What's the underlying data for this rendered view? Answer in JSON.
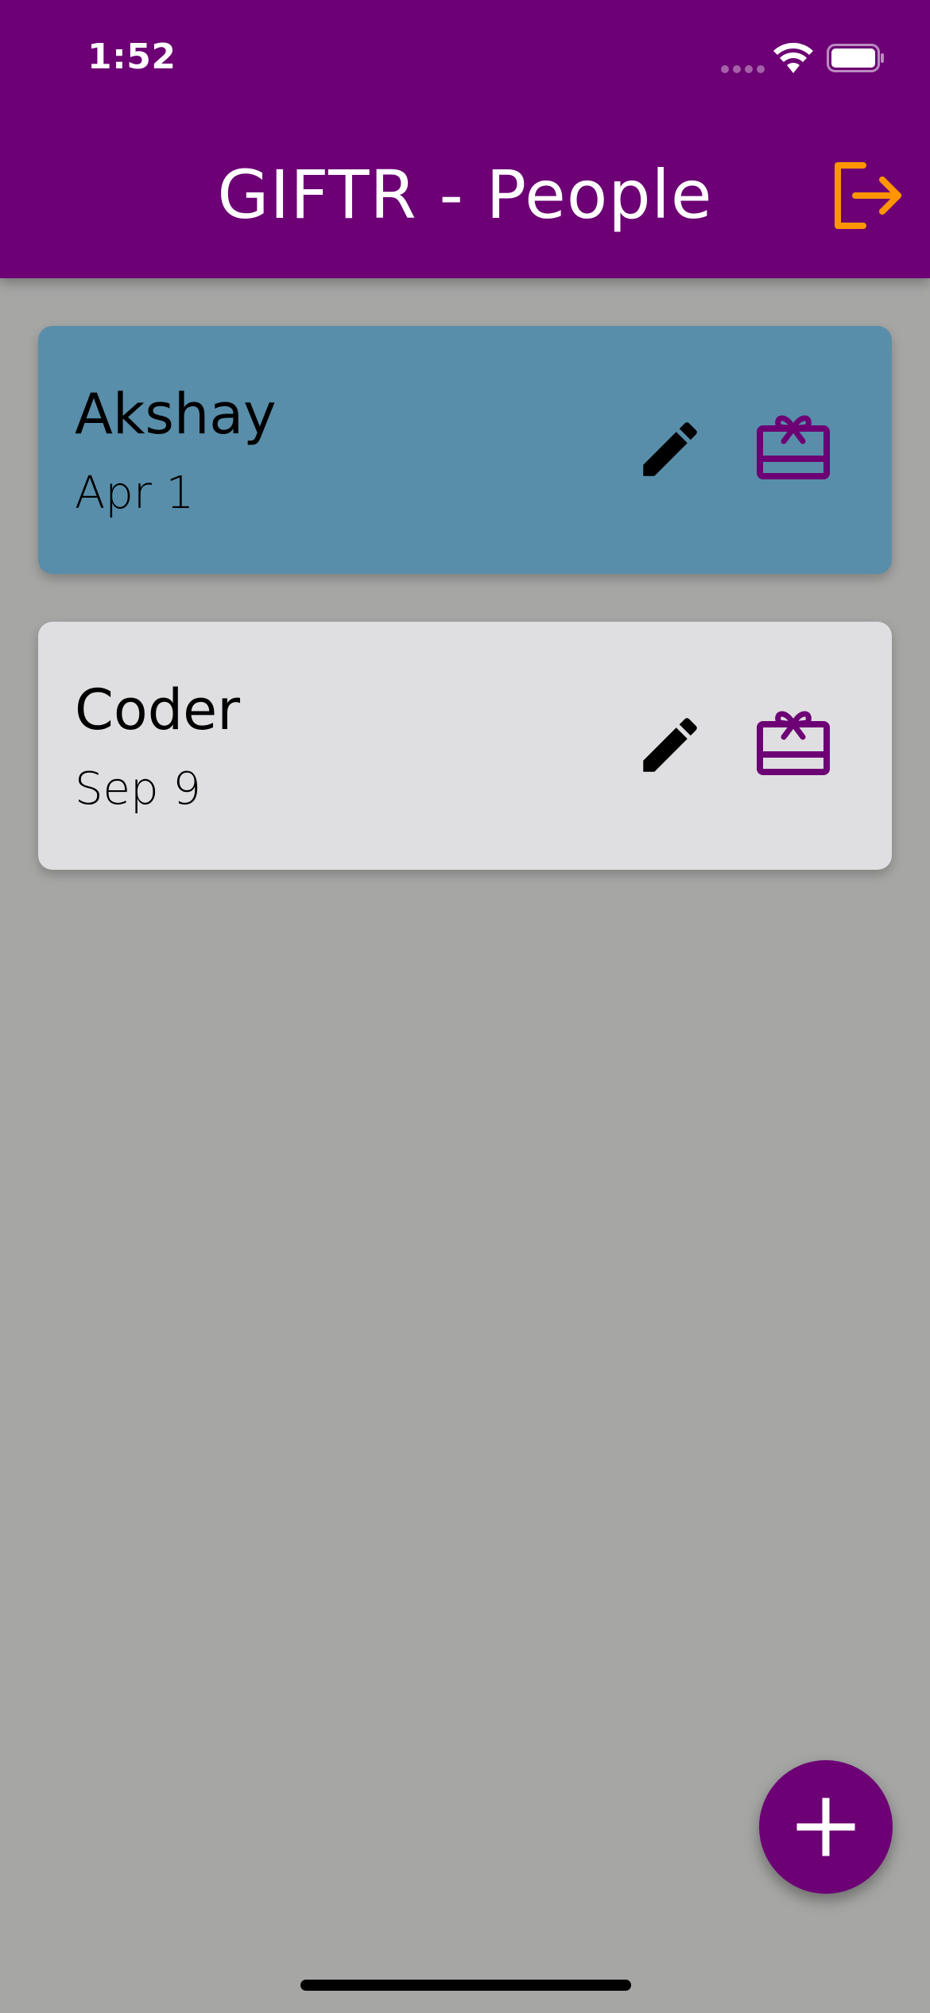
{
  "status_bar": {
    "time": "1:52"
  },
  "app_bar": {
    "title": "GIFTR - People",
    "logout_icon": "logout-icon"
  },
  "people": [
    {
      "name": "Akshay",
      "dob": "Apr 1",
      "selected": true
    },
    {
      "name": "Coder",
      "dob": "Sep 9",
      "selected": false
    }
  ],
  "fab": {
    "icon": "plus-icon"
  },
  "colors": {
    "app_bar": "#6c0074",
    "accent": "#ff9500",
    "selected_card": "#588ea9",
    "card": "#dfdee0",
    "gift_icon": "#6c0074",
    "background": "#a6a6a5"
  }
}
